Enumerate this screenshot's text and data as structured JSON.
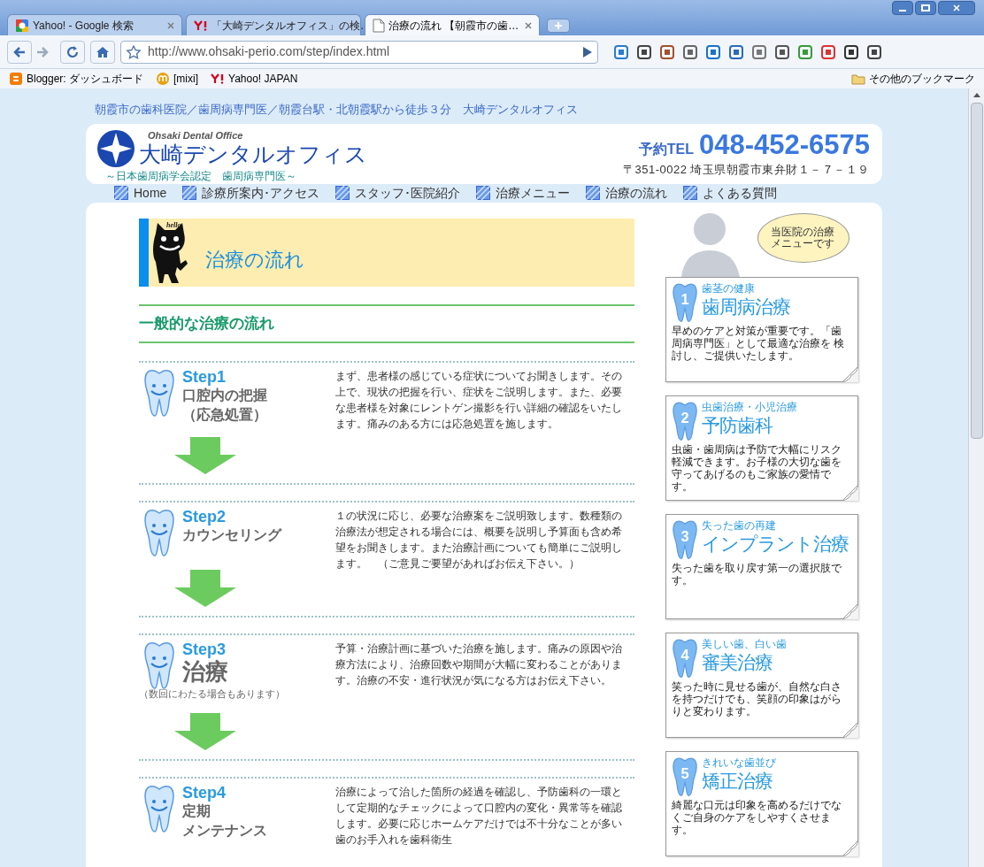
{
  "browser": {
    "tabs": [
      {
        "title": "Yahoo! - Google 検索",
        "kind": "google",
        "selected": false
      },
      {
        "title": "「大崎デンタルオフィス」の検…",
        "kind": "yahoo",
        "selected": false
      },
      {
        "title": "治療の流れ 【朝霞市の歯…",
        "kind": "page",
        "selected": true
      }
    ],
    "url": "http://www.ohsaki-perio.com/step/index.html",
    "bookmarks": [
      {
        "label": "Blogger: ダッシュボード",
        "kind": "blogger"
      },
      {
        "label": "[mixi]",
        "kind": "mixi"
      },
      {
        "label": "Yahoo!  JAPAN",
        "kind": "yahoo"
      }
    ],
    "other_bookmarks": "その他のブックマーク"
  },
  "page": {
    "tagline": "朝霞市の歯科医院／歯周病専門医／朝霞台駅・北朝霞駅から徒歩３分　大崎デンタルオフィス",
    "logo": {
      "english": "Ohsaki Dental Office",
      "name": "大崎デンタルオフィス",
      "certification": "～日本歯周病学会認定　歯周病専門医～"
    },
    "contact": {
      "label": "予約TEL",
      "phone": "048-452-6575",
      "address": "〒351-0022 埼玉県朝霞市東弁財１－７－１９"
    },
    "nav": [
      "Home",
      "診療所案内･アクセス",
      "スタッフ･医院紹介",
      "治療メニュー",
      "治療の流れ",
      "よくある質問"
    ],
    "mascot_greeting": "hello",
    "page_title": "治療の流れ",
    "section_heading": "一般的な治療の流れ",
    "steps": [
      {
        "step": "Step1",
        "title_lines": [
          "口腔内の把握",
          "（応急処置）"
        ],
        "emphasis": false,
        "description": "まず、患者様の感じている症状についてお聞きします。その上で、現状の把握を行い、症状をご説明します。また、必要な患者様を対象にレントゲン撮影を行い詳細の確認をいたします。痛みのある方には応急処置を施します。"
      },
      {
        "step": "Step2",
        "title_lines": [
          "カウンセリング"
        ],
        "emphasis": false,
        "description": "１の状況に応じ、必要な治療案をご説明致します。数種類の治療法が想定される場合には、概要を説明し予算面も含め希望をお聞きします。また治療計画についても簡単にご説明します。　（ご意見ご要望があればお伝え下さい。）"
      },
      {
        "step": "Step3",
        "title_lines": [
          "治療"
        ],
        "emphasis": true,
        "note": "（数回にわたる場合もあります）",
        "description": "予算・治療計画に基づいた治療を施します。痛みの原因や治療方法により、治療回数や期間が大幅に変わることがあります。治療の不安・進行状況が気になる方はお伝え下さい。"
      },
      {
        "step": "Step4",
        "title_lines": [
          "定期",
          "メンテナンス"
        ],
        "emphasis": false,
        "description": "治療によって治した箇所の経過を確認し、予防歯科の一環として定期的なチェックによって口腔内の変化・異常等を確認します。必要に応じホームケアだけでは不十分なことが多い歯のお手入れを歯科衛生"
      }
    ],
    "menu_bubble": "当医院の治療メニューです",
    "menu": [
      {
        "number": "1",
        "subtitle": "歯茎の健康",
        "title": "歯周病治療",
        "description": "早めのケアと対策が重要です。「歯周病専門医」として最適な治療を 検討し、ご提供いたします。"
      },
      {
        "number": "2",
        "subtitle": "虫歯治療・小児治療",
        "title": "予防歯科",
        "description": "虫歯・歯周病は予防で大幅にリスク軽減できます。お子様の大切な歯を守ってあげるのもご家族の愛情です。"
      },
      {
        "number": "3",
        "subtitle": "失った歯の再建",
        "title": "インプラント治療",
        "description": "失った歯を取り戻す第一の選択肢です。"
      },
      {
        "number": "4",
        "subtitle": "美しい歯、白い歯",
        "title": "審美治療",
        "description": "笑った時に見せる歯が、自然な白さを持つだけでも、笑顔の印象はがらりと変わります。"
      },
      {
        "number": "5",
        "subtitle": "きれいな歯並び",
        "title": "矯正治療",
        "description": "綺麗な口元は印象を高めるだけでなくご自身のケアをしやすくさせます。"
      }
    ]
  }
}
